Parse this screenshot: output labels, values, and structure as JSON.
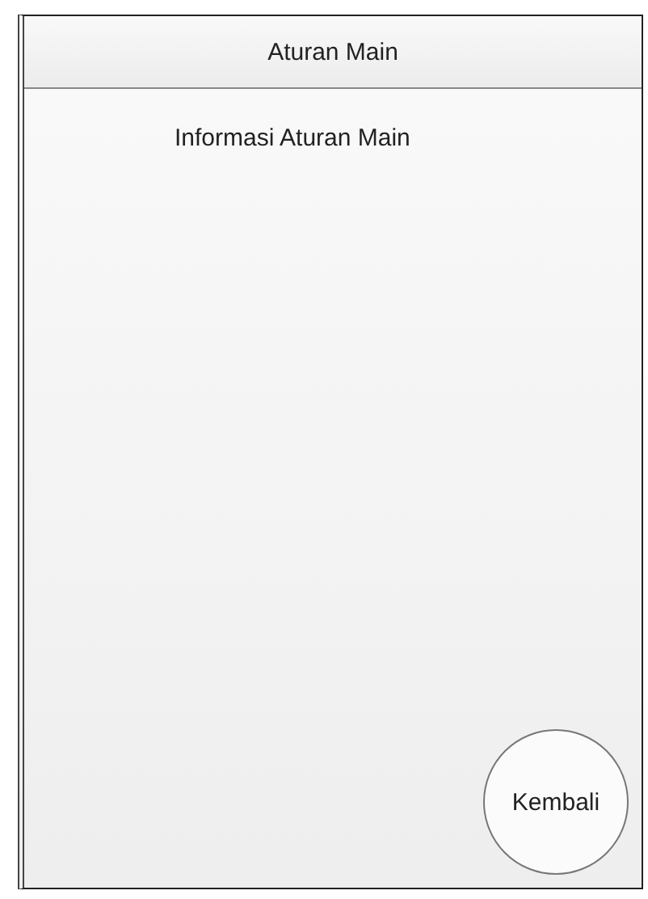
{
  "header": {
    "title": "Aturan Main"
  },
  "content": {
    "heading": "Informasi Aturan Main"
  },
  "buttons": [
    {
      "label": "Kembali"
    }
  ]
}
